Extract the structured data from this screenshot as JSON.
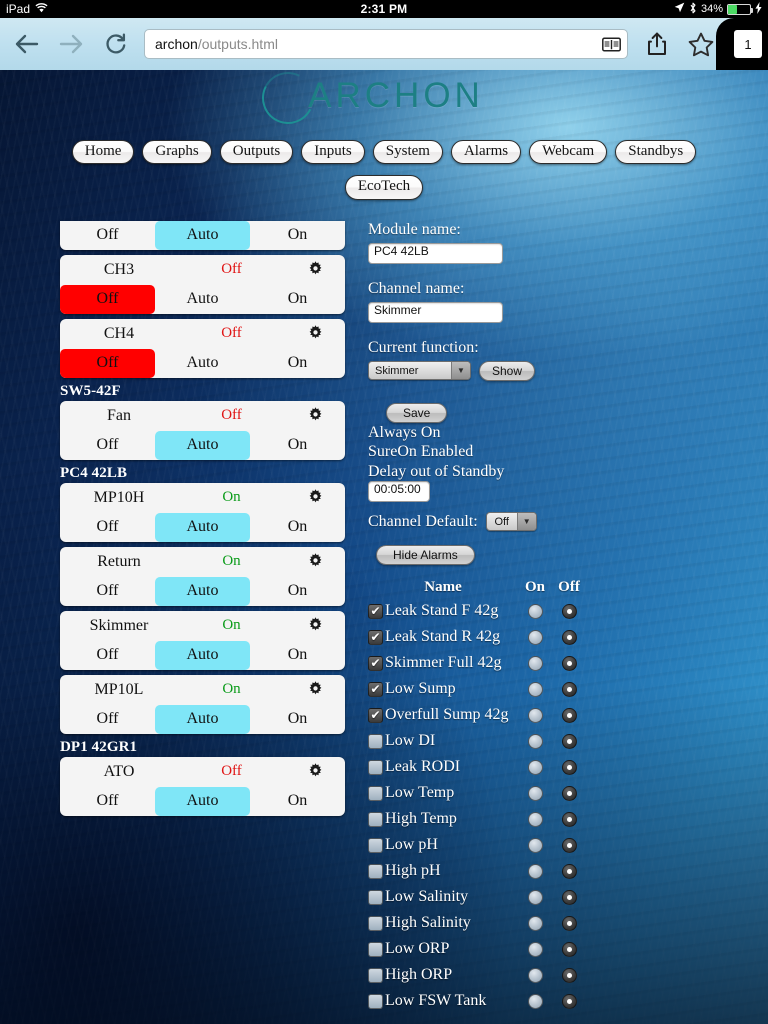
{
  "status_bar": {
    "device": "iPad",
    "wifi_icon": "wifi-icon",
    "time": "2:31 PM",
    "location_icon": "location-arrow-icon",
    "bluetooth_icon": "bluetooth-icon",
    "battery_percent": "34%",
    "battery_fill": 40,
    "charging_icon": "lightning-bolt-icon"
  },
  "browser": {
    "back_icon": "back-arrow-icon",
    "forward_icon": "forward-arrow-icon",
    "reload_icon": "reload-icon",
    "url_host": "archon",
    "url_path": "/outputs.html",
    "reader_icon": "reader-view-icon",
    "share_icon": "share-icon",
    "bookmark_icon": "bookmark-star-icon",
    "tab_count": "1"
  },
  "site": {
    "logo_text": "ARCHON",
    "nav_row1": [
      "Home",
      "Graphs",
      "Outputs",
      "Inputs",
      "System",
      "Alarms",
      "Webcam",
      "Standbys"
    ],
    "nav_row2": [
      "EcoTech"
    ]
  },
  "channels": {
    "clipped_first": {
      "buttons": [
        "Off",
        "Auto",
        "On"
      ],
      "selected": "Auto"
    },
    "groups": [
      {
        "header": null,
        "rows": [
          {
            "name": "CH3",
            "state": "Off",
            "state_kind": "off",
            "gear": "gear-icon",
            "buttons": [
              "Off",
              "Auto",
              "On"
            ],
            "selected": "Off"
          },
          {
            "name": "CH4",
            "state": "Off",
            "state_kind": "off",
            "gear": "gear-icon",
            "buttons": [
              "Off",
              "Auto",
              "On"
            ],
            "selected": "Off"
          }
        ]
      },
      {
        "header": "SW5-42F",
        "rows": [
          {
            "name": "Fan",
            "state": "Off",
            "state_kind": "off",
            "gear": "gear-icon",
            "buttons": [
              "Off",
              "Auto",
              "On"
            ],
            "selected": "Auto"
          }
        ]
      },
      {
        "header": "PC4 42LB",
        "rows": [
          {
            "name": "MP10H",
            "state": "On",
            "state_kind": "on",
            "gear": "gear-icon",
            "buttons": [
              "Off",
              "Auto",
              "On"
            ],
            "selected": "Auto"
          },
          {
            "name": "Return",
            "state": "On",
            "state_kind": "on",
            "gear": "gear-icon",
            "buttons": [
              "Off",
              "Auto",
              "On"
            ],
            "selected": "Auto"
          },
          {
            "name": "Skimmer",
            "state": "On",
            "state_kind": "on",
            "gear": "gear-icon",
            "buttons": [
              "Off",
              "Auto",
              "On"
            ],
            "selected": "Auto"
          },
          {
            "name": "MP10L",
            "state": "On",
            "state_kind": "on",
            "gear": "gear-icon",
            "buttons": [
              "Off",
              "Auto",
              "On"
            ],
            "selected": "Auto"
          }
        ]
      },
      {
        "header": "DP1 42GR1",
        "rows": [
          {
            "name": "ATO",
            "state": "Off",
            "state_kind": "off",
            "gear": "gear-icon",
            "buttons": [
              "Off",
              "Auto",
              "On"
            ],
            "selected": "Auto"
          }
        ]
      }
    ]
  },
  "detail": {
    "module_name_label": "Module name:",
    "module_name_value": "PC4 42LB",
    "channel_name_label": "Channel name:",
    "channel_name_value": "Skimmer",
    "current_function_label": "Current function:",
    "current_function_value": "Skimmer",
    "show_button": "Show",
    "save_button": "Save",
    "always_on": "Always On",
    "sureon_enabled": "SureOn Enabled",
    "delay_out_of_standby": "Delay out of Standby",
    "delay_value": "00:05:00",
    "channel_default_label": "Channel Default:",
    "channel_default_value": "Off",
    "hide_alarms_button": "Hide Alarms"
  },
  "alarms": {
    "col_name": "Name",
    "col_on": "On",
    "col_off": "Off",
    "rows": [
      {
        "name": "Leak Stand F 42g",
        "checked": true,
        "mode": "Off"
      },
      {
        "name": "Leak Stand R 42g",
        "checked": true,
        "mode": "Off"
      },
      {
        "name": "Skimmer Full 42g",
        "checked": true,
        "mode": "Off"
      },
      {
        "name": "Low Sump",
        "checked": true,
        "mode": "Off"
      },
      {
        "name": "Overfull Sump 42g",
        "checked": true,
        "mode": "Off"
      },
      {
        "name": "Low DI",
        "checked": false,
        "mode": "Off"
      },
      {
        "name": "Leak RODI",
        "checked": false,
        "mode": "Off"
      },
      {
        "name": "Low Temp",
        "checked": false,
        "mode": "Off"
      },
      {
        "name": "High Temp",
        "checked": false,
        "mode": "Off"
      },
      {
        "name": "Low pH",
        "checked": false,
        "mode": "Off"
      },
      {
        "name": "High pH",
        "checked": false,
        "mode": "Off"
      },
      {
        "name": "Low Salinity",
        "checked": false,
        "mode": "Off"
      },
      {
        "name": "High Salinity",
        "checked": false,
        "mode": "Off"
      },
      {
        "name": "Low ORP",
        "checked": false,
        "mode": "Off"
      },
      {
        "name": "High ORP",
        "checked": false,
        "mode": "Off"
      },
      {
        "name": "Low FSW Tank",
        "checked": false,
        "mode": "Off"
      }
    ]
  },
  "colors": {
    "auto_selected": "#7fe6f7",
    "off_selected": "#ff0000",
    "state_on": "#0a9b19",
    "state_off": "#e01414",
    "battery_green": "#4cd964"
  }
}
